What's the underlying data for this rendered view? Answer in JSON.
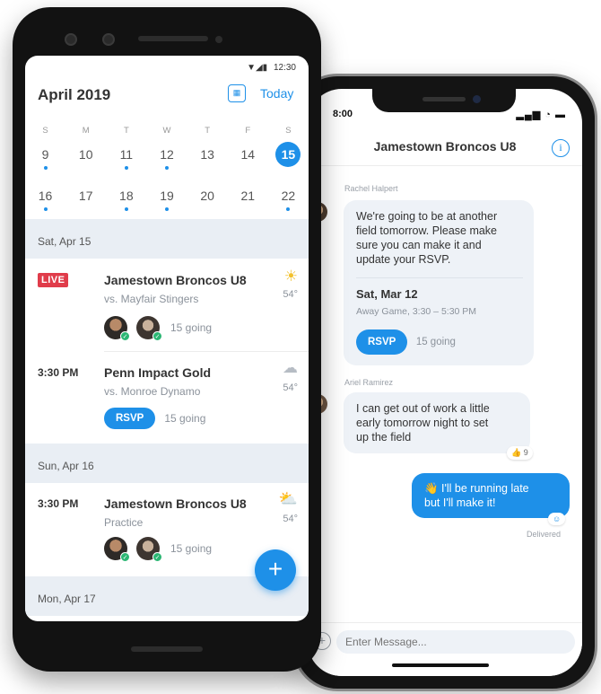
{
  "chat": {
    "status_time": "8:00",
    "status_icons": "▂▄▆ ◔ ▬",
    "back_glyph": "‹",
    "title": "Jamestown Broncos U8",
    "info_glyph": "i",
    "messages": [
      {
        "sender": "Rachel Halpert",
        "lines": [
          "We're going to be at another",
          "field tomorrow. Please make",
          "sure you can make it and",
          "update your RSVP."
        ],
        "event_title": "Sat, Mar 12",
        "event_sub": "Away Game, 3:30 – 5:30 PM",
        "rsvp": "RSVP",
        "going": "15 going"
      },
      {
        "sender": "Ariel Ramirez",
        "lines": [
          "I can get out of work a little",
          "early tomorrow night to set",
          "up the field"
        ],
        "reaction": "👍 9"
      },
      {
        "lines": [
          "👋 I'll be running late",
          "but I'll make it!"
        ],
        "reaction": "☺",
        "status": "Delivered"
      }
    ],
    "composer_plus": "+",
    "composer_placeholder": "Enter Message..."
  },
  "calendar": {
    "status_icons": "▼◢▮",
    "status_time": "12:30",
    "month": "April 2019",
    "cal_icon": "▦",
    "today_label": "Today",
    "weekdays": [
      "S",
      "M",
      "T",
      "W",
      "T",
      "F",
      "S"
    ],
    "week1": [
      "9",
      "10",
      "11",
      "12",
      "13",
      "14",
      "15"
    ],
    "week2": [
      "16",
      "17",
      "18",
      "19",
      "20",
      "21",
      "22"
    ],
    "dates": [
      "Sat, Apr 15",
      "Sun, Apr 16",
      "Mon, Apr 17"
    ],
    "events": [
      {
        "time": "LIVE",
        "team": "Jamestown Broncos U8",
        "opponent": "vs. Mayfair Stingers",
        "weather": "☀",
        "temp": "54°",
        "going": "15 going"
      },
      {
        "time": "3:30 PM",
        "team": "Penn Impact Gold",
        "opponent": "vs. Monroe Dynamo",
        "weather": "☁",
        "temp": "54°",
        "rsvp": "RSVP",
        "going": "15 going"
      },
      {
        "time": "3:30 PM",
        "team": "Jamestown Broncos U8",
        "opponent": "Practice",
        "weather": "⛅",
        "temp": "54°",
        "going": "15 going"
      }
    ],
    "fab": "+",
    "check": "✓"
  },
  "colors": {
    "accent": "#1e90e8",
    "live": "#e03c4a",
    "date_band": "#e9eef4",
    "going_check": "#2bb673"
  }
}
